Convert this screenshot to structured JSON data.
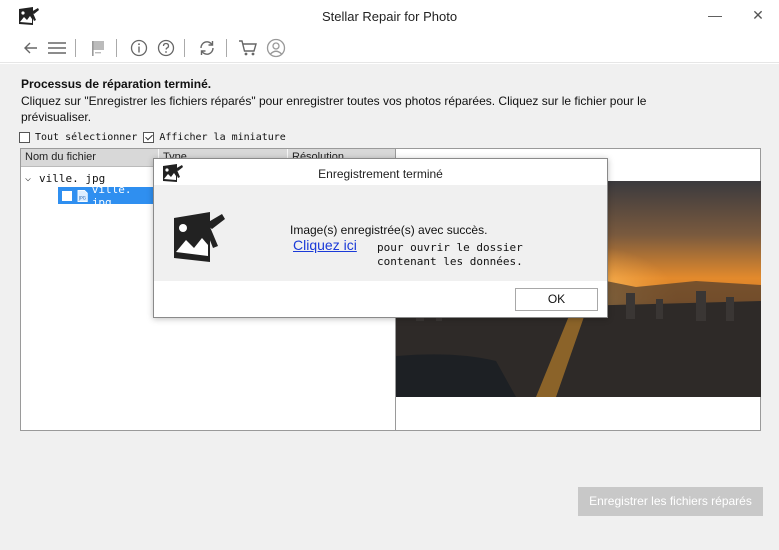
{
  "window": {
    "title": "Stellar Repair for Photo",
    "minimize": "—",
    "close": "✕"
  },
  "toolbar": {
    "icons": [
      "back-arrow-icon",
      "hamburger-menu-icon",
      "flag-icon",
      "info-icon",
      "help-icon",
      "refresh-icon",
      "cart-icon",
      "user-icon"
    ]
  },
  "main": {
    "heading": "Processus de réparation terminé.",
    "description": "Cliquez sur \"Enregistrer les fichiers réparés\" pour enregistrer toutes vos photos réparées. Cliquez sur le fichier pour le prévisualiser.",
    "select_all_label": "Tout sélectionner",
    "show_thumbnail_label": "Afficher la miniature",
    "show_thumbnail_checked": true,
    "select_all_checked": false
  },
  "file_table": {
    "columns": [
      "Nom du fichier",
      "Type",
      "Résolution"
    ],
    "parent_row": "ville. jpg",
    "child_row": "ville. jpg"
  },
  "save_button": "Enregistrer les fichiers réparés",
  "dialog": {
    "title": "Enregistrement terminé",
    "message": "Image(s) enregistrée(s) avec succès.",
    "link": "Cliquez ici",
    "link_suffix": "pour ouvrir le dossier contenant les données.",
    "ok": "OK"
  },
  "colors": {
    "selection": "#2f8ff0",
    "link": "#1a3ad8",
    "disabled_button": "#c8c8c8"
  }
}
